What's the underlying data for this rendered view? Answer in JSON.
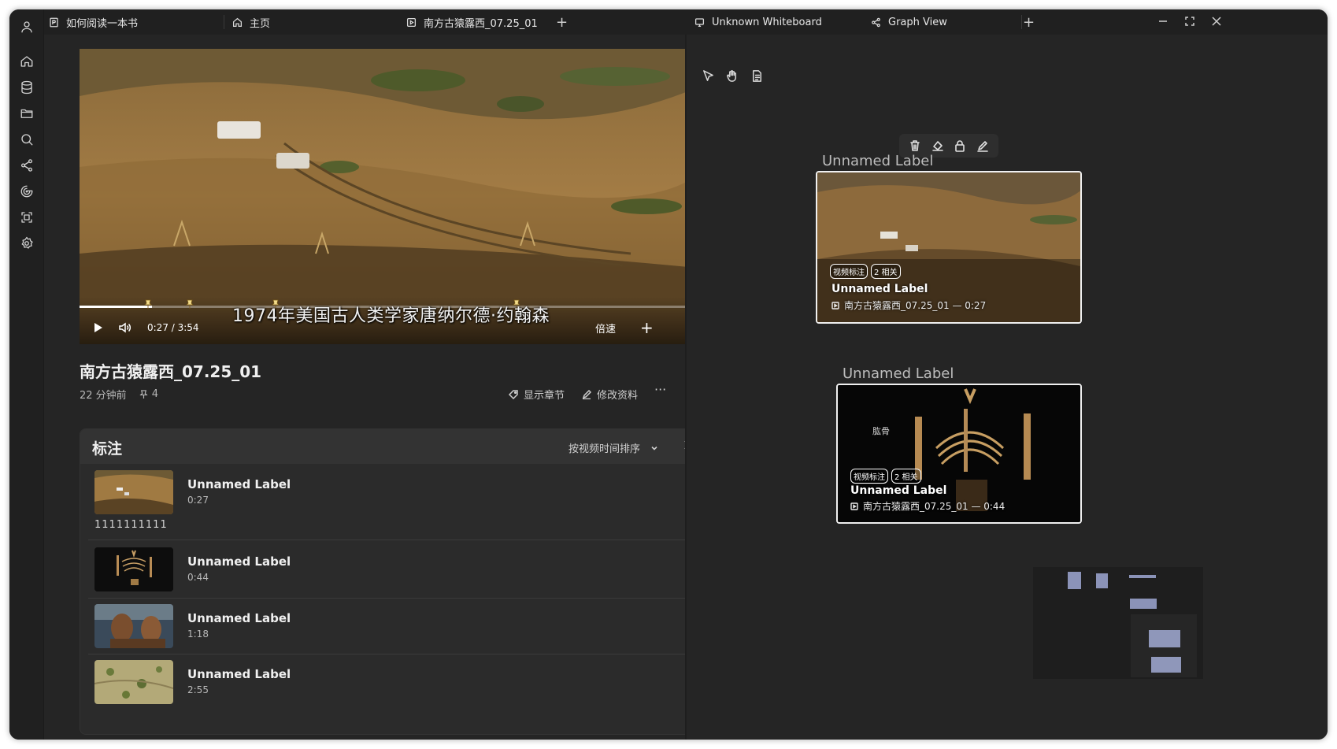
{
  "tabs_left": [
    {
      "title": "如何阅读一本书",
      "icon": "document-p-icon"
    },
    {
      "title": "主页",
      "icon": "home-icon"
    },
    {
      "title": "南方古猿露西_07.25_01",
      "icon": "video-icon"
    }
  ],
  "tabs_right": [
    {
      "title": "Unknown Whiteboard",
      "icon": "whiteboard-icon"
    },
    {
      "title": "Graph View",
      "icon": "graph-icon"
    }
  ],
  "tab_add_label": "+",
  "sidebar_icons": [
    "user-icon",
    "home-icon",
    "database-icon",
    "folder-icon",
    "search-icon",
    "graph-icon",
    "spiral-icon",
    "scan-icon",
    "settings-icon"
  ],
  "video": {
    "subtitle": "1974年美国古人类学家唐纳尔德·约翰森",
    "time": "0:27 / 3:54",
    "speed_label": "倍速",
    "add_label": "+",
    "progress": 0.115
  },
  "video_info": {
    "title": "南方古猿露西_07.25_01",
    "age": "22 分钟前",
    "pin_count": "4",
    "show_chapters": "显示章节",
    "edit_info": "修改资料",
    "more": "···"
  },
  "annotations_panel": {
    "title": "标注",
    "sort_label": "按视频时间排序",
    "items": [
      {
        "label": "Unnamed Label",
        "time": "0:27",
        "note": "1111111111",
        "more": "···"
      },
      {
        "label": "Unnamed Label",
        "time": "0:44",
        "more": "···"
      },
      {
        "label": "Unnamed Label",
        "time": "1:18",
        "more": "···"
      },
      {
        "label": "Unnamed Label",
        "time": "2:55",
        "more": "···"
      }
    ]
  },
  "whiteboard": {
    "tools": [
      "pointer-icon",
      "hand-icon",
      "note-icon"
    ],
    "card_toolbar": [
      "trash-icon",
      "fill-icon",
      "lock-icon",
      "edit-icon"
    ],
    "cards": [
      {
        "outer_label": "Unnamed Label",
        "chip1": "视频标注",
        "chip2": "2 相关",
        "name": "Unnamed Label",
        "source": "南方古猿露西_07.25_01 — 0:27"
      },
      {
        "outer_label": "Unnamed Label",
        "inner_text": "肱骨",
        "chip1": "视频标注",
        "chip2": "2 相关",
        "name": "Unnamed Label",
        "source": "南方古猿露西_07.25_01 — 0:44"
      }
    ]
  }
}
